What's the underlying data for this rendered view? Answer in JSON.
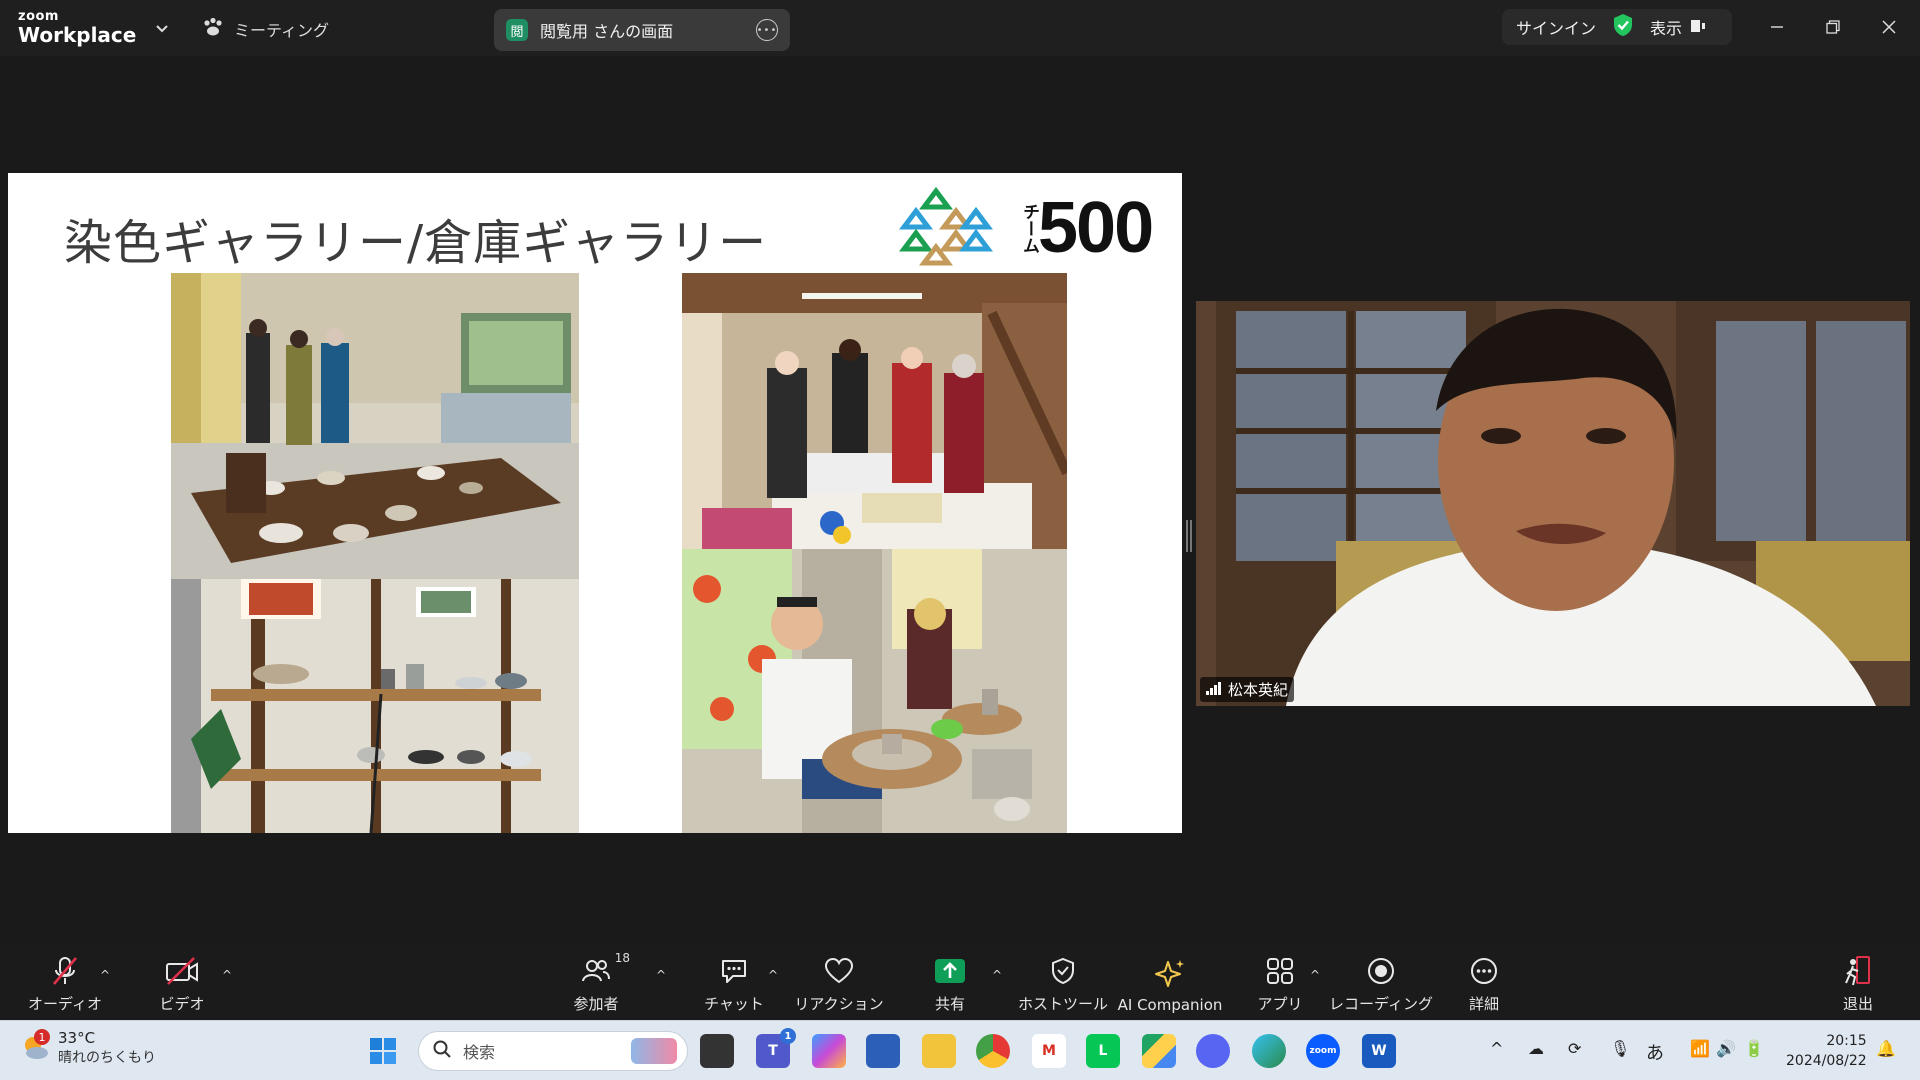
{
  "window": {
    "brand_small": "zoom",
    "brand_big": "Workplace",
    "meeting_label": "ミーティング",
    "share_badge": "閲",
    "share_title": "閲覧用 さんの画面",
    "signin_label": "サインイン",
    "view_label": "表示"
  },
  "slide": {
    "title": "染色ギャラリー/倉庫ギャラリー",
    "logo_text": "500",
    "logo_side": "チーム",
    "photos": [
      {
        "name": "dye-gallery-photo"
      },
      {
        "name": "dyeing-workshop-photo"
      },
      {
        "name": "warehouse-gallery-photo"
      },
      {
        "name": "pottery-wheel-photo"
      }
    ]
  },
  "video": {
    "speaker_name": "松本英紀"
  },
  "toolbar": {
    "audio": "オーディオ",
    "video": "ビデオ",
    "participants": "参加者",
    "participants_count": "18",
    "chat": "チャット",
    "reactions": "リアクション",
    "share": "共有",
    "host_tools": "ホストツール",
    "ai_companion": "AI Companion",
    "apps": "アプリ",
    "recording": "レコーディング",
    "more": "詳細",
    "leave": "退出"
  },
  "taskbar": {
    "temperature": "33°C",
    "weather_desc": "晴れのちくもり",
    "weather_badge": "1",
    "search_placeholder": "検索",
    "teams_badge": "1",
    "ime": "あ",
    "time": "20:15",
    "date": "2024/08/22"
  },
  "colors": {
    "accent_green": "#0e9e58",
    "ai_gold": "#f2c94c",
    "leave_red": "#e0314b",
    "title_bar": "#1f1f1f"
  }
}
